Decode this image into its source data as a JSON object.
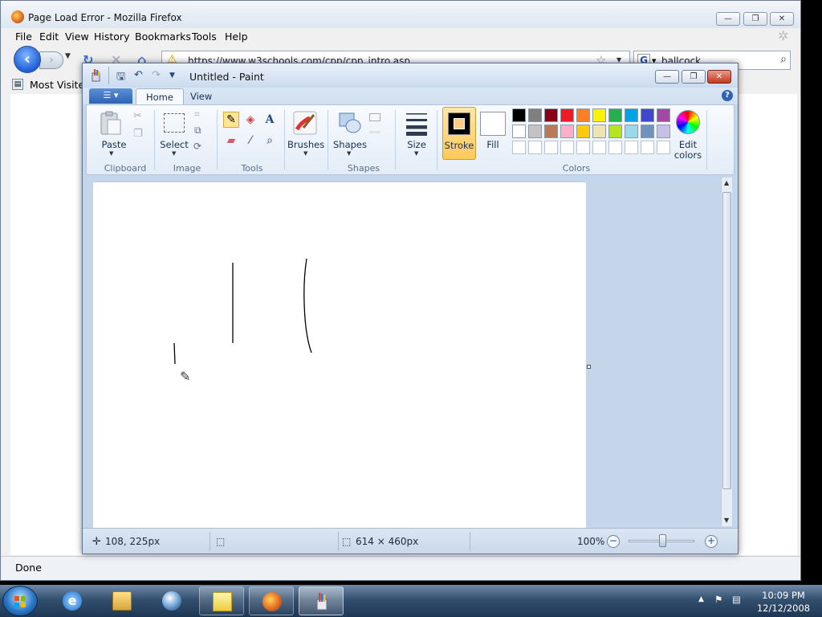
{
  "firefox": {
    "title": "Page Load Error - Mozilla Firefox",
    "menu": [
      "File",
      "Edit",
      "View",
      "History",
      "Bookmarks",
      "Tools",
      "Help"
    ],
    "url": "https://www.w3schools.com/cpp/cpp_intro.asp",
    "search_value": "ballcock",
    "bookmark_label": "Most Visited",
    "status_text": "Done"
  },
  "paint": {
    "title": "Untitled - Paint",
    "tabs": [
      "Home",
      "View"
    ],
    "groups": {
      "clipboard": "Clipboard",
      "image": "Image",
      "tools": "Tools",
      "shapes": "Shapes",
      "colors": "Colors"
    },
    "buttons": {
      "paste": "Paste",
      "select": "Select",
      "brushes": "Brushes",
      "shapes": "Shapes",
      "size": "Size",
      "stroke": "Stroke",
      "fill": "Fill",
      "edit_colors_1": "Edit",
      "edit_colors_2": "colors"
    },
    "stroke_color": "#000000",
    "fill_color": "#ffffff",
    "palette": [
      "#000000",
      "#7f7f7f",
      "#880015",
      "#ed1c24",
      "#ff7f27",
      "#fff200",
      "#22b14c",
      "#00a2e8",
      "#3f48cc",
      "#a349a4",
      "#ffffff",
      "#c3c3c3",
      "#b97a57",
      "#ffaec9",
      "#ffc90e",
      "#efe4b0",
      "#b5e61d",
      "#99d9ea",
      "#7092be",
      "#c8bfe7"
    ],
    "status": {
      "cursor_pos": "108, 225px",
      "canvas_size": "614 × 460px",
      "zoom": "100%"
    }
  },
  "taskbar": {
    "time": "10:09 PM",
    "date": "12/12/2008"
  }
}
